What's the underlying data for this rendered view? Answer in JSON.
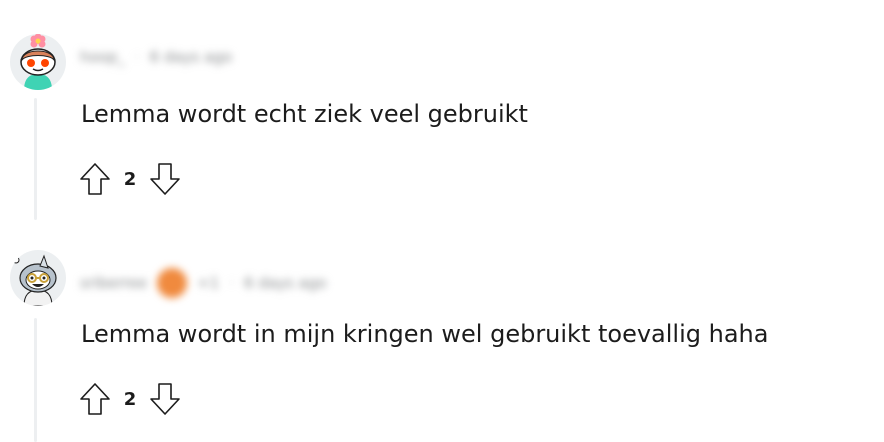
{
  "comments": [
    {
      "author": "hoop_",
      "timestamp": "6 days ago",
      "body": "Lemma wordt echt ziek veel gebruikt",
      "score": "2",
      "upvote_icon": "arrow-up-outline-icon",
      "downvote_icon": "arrow-down-outline-icon"
    },
    {
      "author": "sriberree",
      "flair_count": "+1",
      "timestamp": "6 days ago",
      "body": "Lemma wordt in mijn kringen wel gebruikt toevallig haha",
      "score": "2",
      "upvote_icon": "arrow-up-outline-icon",
      "downvote_icon": "arrow-down-outline-icon"
    }
  ],
  "colors": {
    "thread_line": "#edeff1",
    "text": "#1c1c1c",
    "muted": "#878a8c",
    "avatar1_shirt": "#3fd3b4",
    "avatar1_flower": "#ff8fa3",
    "flair": "#f08a3e"
  }
}
